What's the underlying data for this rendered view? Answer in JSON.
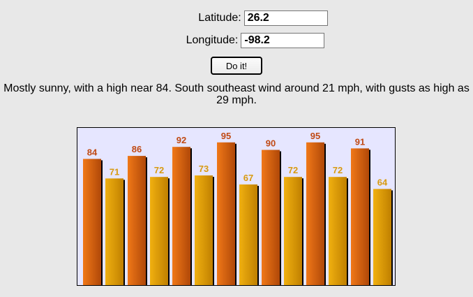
{
  "form": {
    "latitude_label": "Latitude:",
    "latitude_value": "26.2",
    "longitude_label": "Longitude:",
    "longitude_value": "-98.2",
    "submit_label": "Do it!"
  },
  "forecast_text": "Mostly sunny, with a high near 84. South southeast wind around 21 mph, with gusts as high as 29 mph.",
  "chart_data": {
    "type": "bar",
    "title": "",
    "xlabel": "",
    "ylabel": "",
    "ylim": [
      0,
      100
    ],
    "values": [
      84,
      71,
      86,
      72,
      92,
      73,
      95,
      67,
      90,
      72,
      95,
      72,
      91,
      64
    ],
    "kinds": [
      "high",
      "low",
      "high",
      "low",
      "high",
      "low",
      "high",
      "low",
      "high",
      "low",
      "high",
      "low",
      "high",
      "low"
    ],
    "colors": {
      "high_light": "#f07818",
      "high_dark": "#b04808",
      "high_label": "#c04a14",
      "low_light": "#f0b010",
      "low_dark": "#c08000",
      "low_label": "#d89a10",
      "background": "#e6e6ff"
    }
  }
}
